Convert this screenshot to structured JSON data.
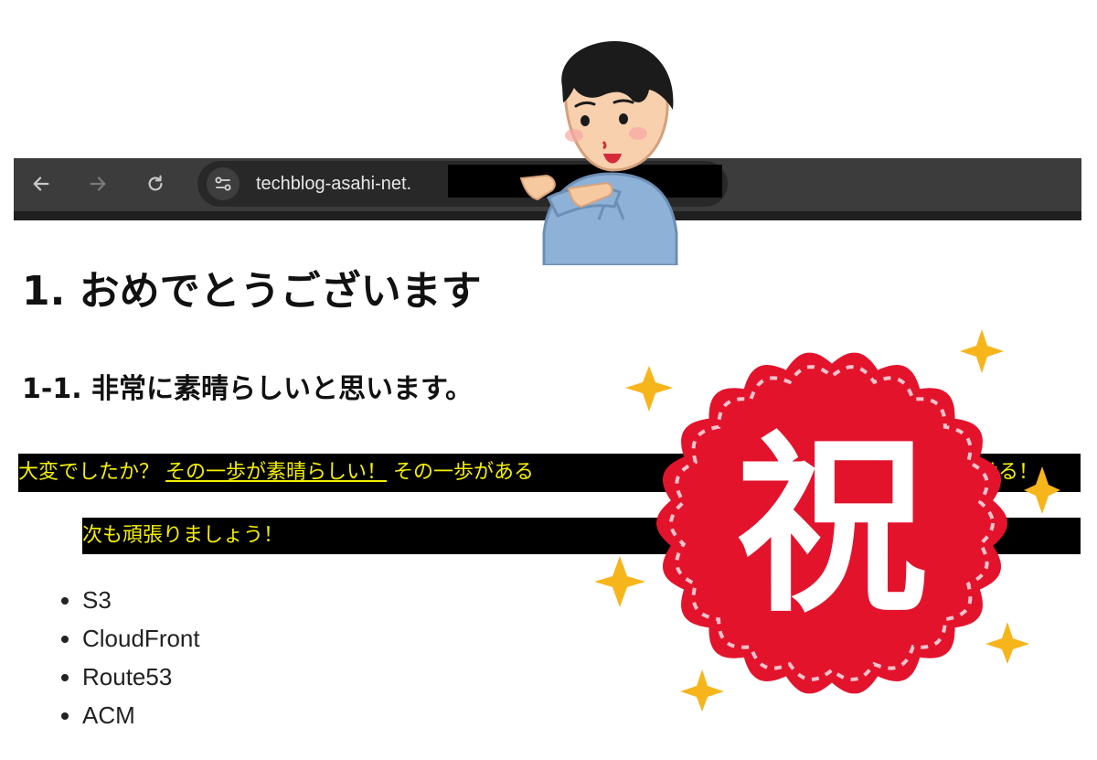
{
  "browser": {
    "url_visible": "techblog-asahi-net.",
    "icons": {
      "back": "arrow-left-icon",
      "forward": "arrow-right-icon",
      "reload": "reload-icon",
      "site_info": "tune-icon"
    }
  },
  "page": {
    "heading1": "1. おめでとうございます",
    "heading2": "1-1. 非常に素晴らしいと思います。",
    "marker_line": {
      "prefix": "大変でしたか？",
      "link": "その一歩が素晴らしい！",
      "middle": "その一歩がある",
      "tail": "ける！"
    },
    "marker_line2": "次も頑張りましょう！",
    "services": [
      "S3",
      "CloudFront",
      "Route53",
      "ACM"
    ]
  },
  "illustrations": {
    "seal_text": "祝"
  },
  "colors": {
    "toolbar": "#3c3c3c",
    "addressbar": "#282828",
    "marker_bg": "#000000",
    "marker_text": "#f5f000",
    "seal_red": "#e3132c",
    "sparkle": "#f7b51c"
  }
}
